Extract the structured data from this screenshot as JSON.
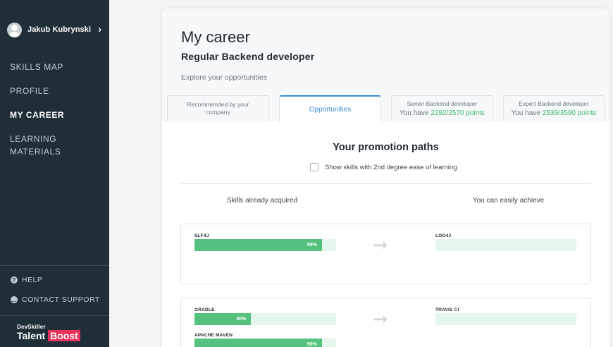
{
  "sidebar": {
    "user_name": "Jakub Kubrynski",
    "nav": {
      "skills_map": "SKILLS MAP",
      "profile": "PROFILE",
      "my_career": "MY CAREER",
      "learning_materials": "LEARNING MATERIALS"
    },
    "help": "HELP",
    "contact_support": "CONTACT SUPPORT",
    "brand_small": "DevSkiller",
    "brand_talent": "Talent",
    "brand_boost": "Boost"
  },
  "main": {
    "title": "My career",
    "subtitle": "Regular Backend developer",
    "explore": "Explore your opportunities",
    "tabs": {
      "recommended": "Recommended by your company",
      "opportunities": "Opportunities",
      "senior": {
        "title": "Senior Backend developer",
        "prefix": "You have",
        "points": "2292/2570 points"
      },
      "expert": {
        "title": "Expert Backend developer",
        "prefix": "You have",
        "points": "2539/3590 points"
      }
    },
    "promotion_title": "Your promotion paths",
    "checkbox_label": "Show skills with 2nd degree ease of learning",
    "col_acquired": "Skills already acquired",
    "col_achieve": "You can easily achieve",
    "paths": [
      {
        "acquired": [
          {
            "name": "SLF4J",
            "percent_label": "90%",
            "percent": 90
          }
        ],
        "achieve": [
          {
            "name": "LOG4J"
          }
        ]
      },
      {
        "acquired": [
          {
            "name": "GRADLE",
            "percent_label": "40%",
            "percent": 40
          },
          {
            "name": "APACHE MAVEN",
            "percent_label": "90%",
            "percent": 90
          }
        ],
        "achieve": [
          {
            "name": "TRAVIS CI"
          }
        ]
      }
    ]
  },
  "colors": {
    "sidebar_bg": "#1f2e37",
    "accent_blue": "#3d8fd6",
    "progress_green": "#54c27e",
    "points_green": "#3fb96f",
    "brand_pink": "#e8315b"
  },
  "icons": [
    "user-avatar",
    "chevron-right-icon",
    "help-icon",
    "chat-icon",
    "arrow-right-icon"
  ]
}
